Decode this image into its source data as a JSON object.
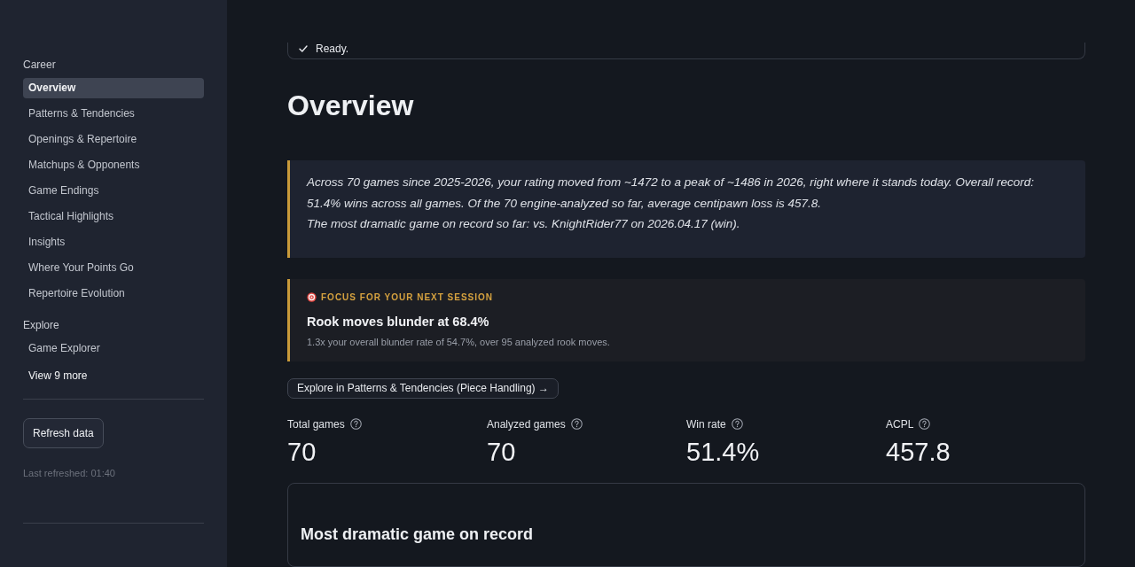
{
  "sidebar": {
    "sections": [
      {
        "heading": "Career",
        "items": [
          {
            "label": "Overview",
            "selected": true
          },
          {
            "label": "Patterns & Tendencies",
            "selected": false
          },
          {
            "label": "Openings & Repertoire",
            "selected": false
          },
          {
            "label": "Matchups & Opponents",
            "selected": false
          },
          {
            "label": "Game Endings",
            "selected": false
          },
          {
            "label": "Tactical Highlights",
            "selected": false
          },
          {
            "label": "Insights",
            "selected": false
          },
          {
            "label": "Where Your Points Go",
            "selected": false
          },
          {
            "label": "Repertoire Evolution",
            "selected": false
          }
        ]
      },
      {
        "heading": "Explore",
        "items": [
          {
            "label": "Game Explorer",
            "selected": false
          }
        ]
      }
    ],
    "more_link": "View 9 more",
    "refresh_button": "Refresh data",
    "last_refreshed": "Last refreshed: 01:40"
  },
  "status": {
    "text": "Ready."
  },
  "page_title": "Overview",
  "summary": {
    "paragraphs": [
      "Across 70 games since 2025-2026, your rating moved from ~1472 to a peak of ~1486 in 2026, right where it stands today. Overall record: 51.4% wins across all games. Of the 70 engine-analyzed so far, average centipawn loss is 457.8.",
      "The most dramatic game on record so far: vs. KnightRider77 on 2026.04.17 (win)."
    ]
  },
  "focus": {
    "label": "FOCUS FOR YOUR NEXT SESSION",
    "title": "Rook moves blunder at 68.4%",
    "detail": "1.3x your overall blunder rate of 54.7%, over 95 analyzed rook moves."
  },
  "explore_button": "Explore in Patterns & Tendencies (Piece Handling) →",
  "metrics": [
    {
      "label": "Total games",
      "value": "70"
    },
    {
      "label": "Analyzed games",
      "value": "70"
    },
    {
      "label": "Win rate",
      "value": "51.4%"
    },
    {
      "label": "ACPL",
      "value": "457.8"
    }
  ],
  "dramatic_card": {
    "title": "Most dramatic game on record"
  }
}
